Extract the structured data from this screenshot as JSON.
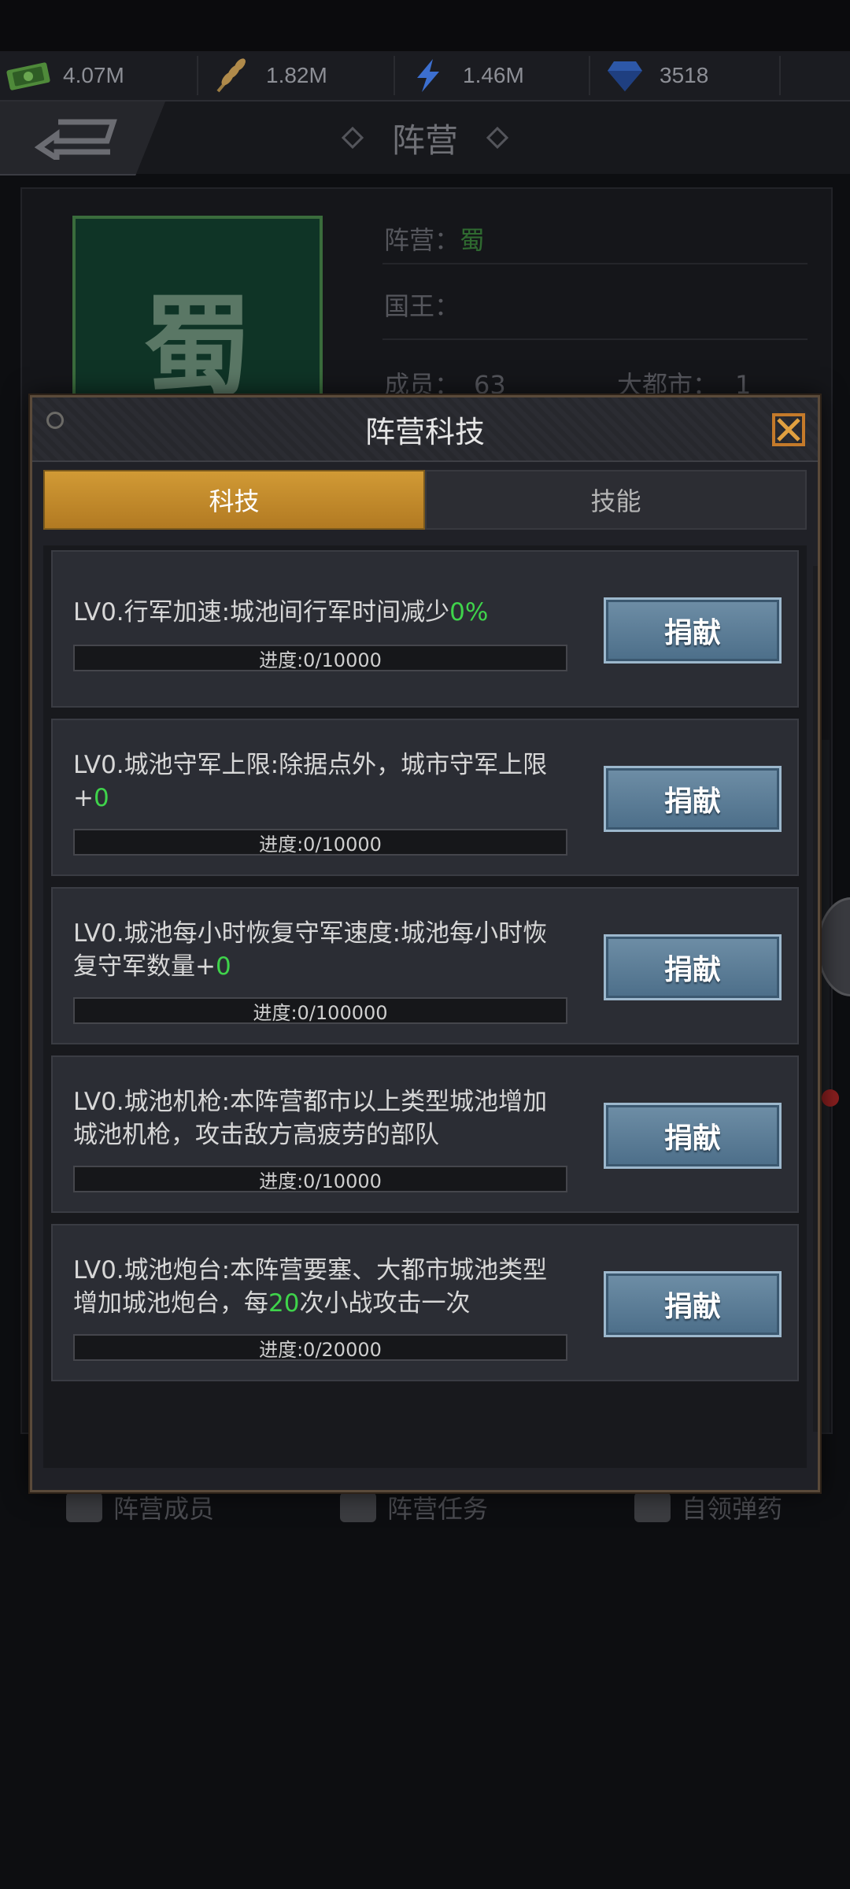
{
  "resources": [
    {
      "icon": "cash-icon",
      "value": "4.07M"
    },
    {
      "icon": "wheat-icon",
      "value": "1.82M"
    },
    {
      "icon": "energy-icon",
      "value": "1.46M"
    },
    {
      "icon": "diamond-icon",
      "value": "3518"
    }
  ],
  "header": {
    "title": "阵营"
  },
  "faction": {
    "flag_char": "蜀",
    "faction_label": "阵营：",
    "faction_value": "蜀",
    "king_label": "国王：",
    "members_label": "成员：",
    "members_value": "63",
    "big_city_label": "大都市：",
    "big_city_value": "1"
  },
  "bottom_tabs": {
    "members": "阵营成员",
    "tasks": "阵营任务",
    "ammo": "自领弹药"
  },
  "modal": {
    "title": "阵营科技",
    "tabs": {
      "tech": "科技",
      "skill": "技能"
    },
    "items": [
      {
        "level": "LV0.",
        "name": "行军加速",
        "desc_before": ":城池间行军时间减少",
        "highlight": "0%",
        "desc_after": "",
        "progress": "进度:0/10000",
        "progress_fraction": 0,
        "button": "捐献"
      },
      {
        "level": "LV0.",
        "name": "城池守军上限",
        "desc_before": ":除据点外，城市守军上限+",
        "highlight": "0",
        "desc_after": "",
        "progress": "进度:0/10000",
        "progress_fraction": 0,
        "button": "捐献"
      },
      {
        "level": "LV0.",
        "name": "城池每小时恢复守军速度",
        "desc_before": ":城池每小时恢复守军数量+",
        "highlight": "0",
        "desc_after": "",
        "progress": "进度:0/100000",
        "progress_fraction": 0,
        "button": "捐献"
      },
      {
        "level": "LV0.",
        "name": "城池机枪",
        "desc_before": ":本阵营都市以上类型城池增加城池机枪，攻击敌方高疲劳的部队",
        "highlight": "",
        "desc_after": "",
        "progress": "进度:0/10000",
        "progress_fraction": 0,
        "button": "捐献"
      },
      {
        "level": "LV0.",
        "name": "城池炮台",
        "desc_before": ":本阵营要塞、大都市城池类型增加城池炮台，每",
        "highlight": "20",
        "desc_after": "次小战攻击一次",
        "progress": "进度:0/20000",
        "progress_fraction": 0,
        "button": "捐献"
      }
    ]
  }
}
